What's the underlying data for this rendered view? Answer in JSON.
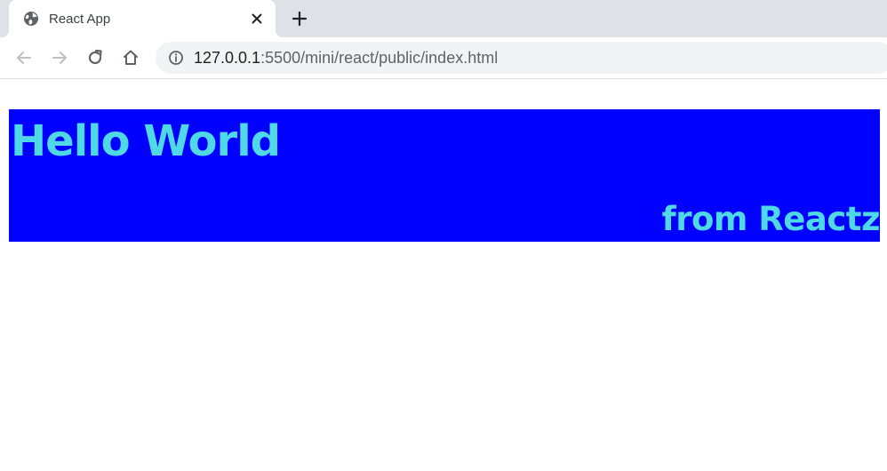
{
  "browser": {
    "tab": {
      "title": "React App",
      "favicon": "globe-icon",
      "close_icon": "close-icon"
    },
    "new_tab_icon": "plus-icon",
    "nav": {
      "back_icon": "arrow-left-icon",
      "forward_icon": "arrow-right-icon",
      "reload_icon": "reload-icon",
      "home_icon": "home-icon"
    },
    "address_bar": {
      "info_icon": "info-icon",
      "url_host": "127.0.0.1",
      "url_rest": ":5500/mini/react/public/index.html"
    }
  },
  "page": {
    "heading": "Hello World",
    "subheading": "from Reactz"
  },
  "colors": {
    "banner_background": "#0000ff",
    "banner_text": "#4fd8e8",
    "tabstrip_background": "#dee1e6",
    "omnibox_background": "#f1f3f4"
  }
}
